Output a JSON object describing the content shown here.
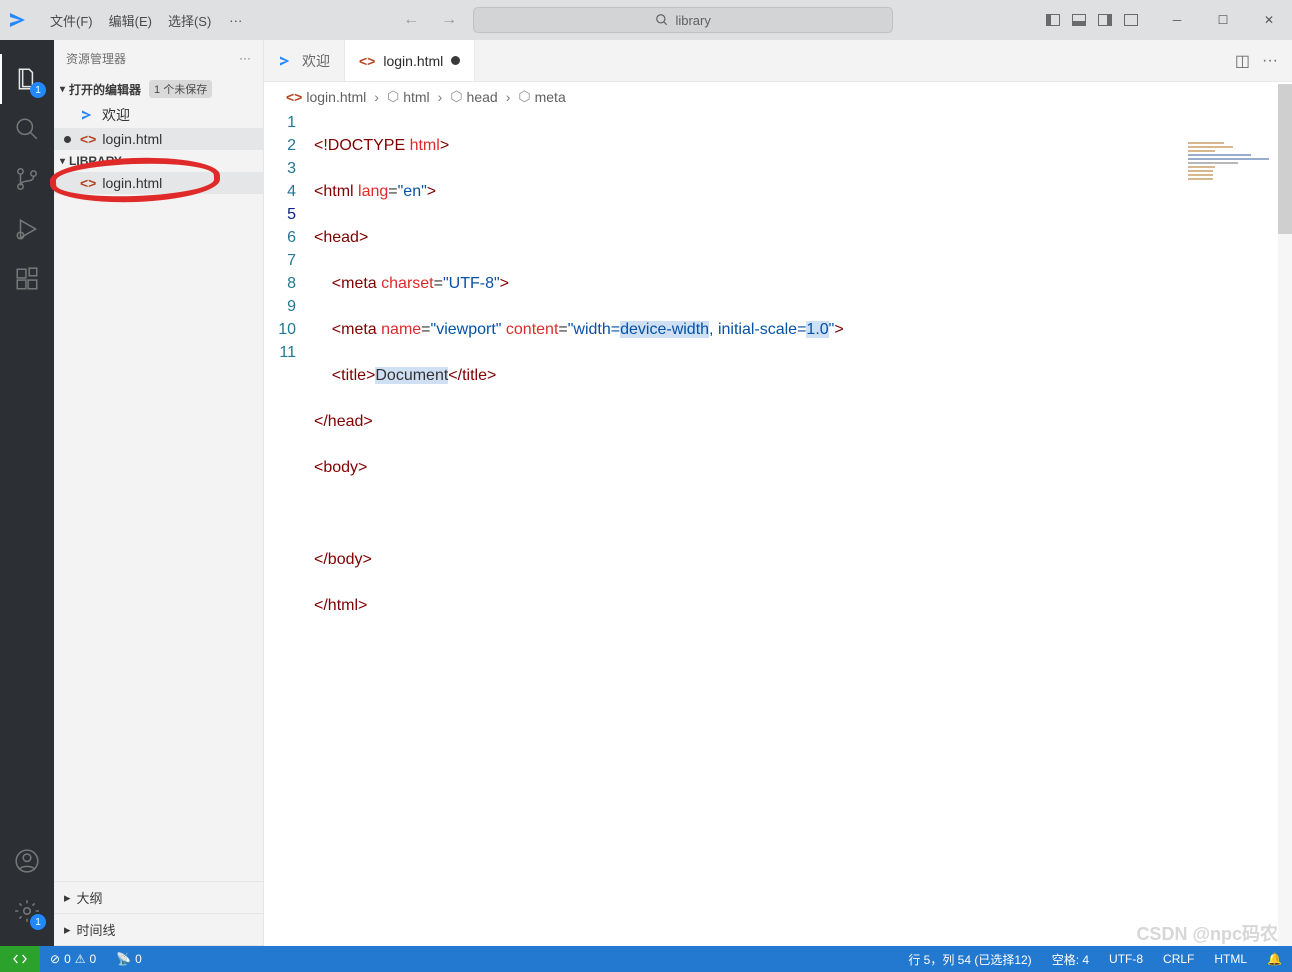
{
  "menu": {
    "file": "文件(F)",
    "edit": "编辑(E)",
    "select": "选择(S)"
  },
  "search": {
    "placeholder": "library"
  },
  "activity": {
    "explorer_badge": "1",
    "settings_badge": "1"
  },
  "sidebar": {
    "title": "资源管理器",
    "open_editors": "打开的编辑器",
    "unsaved": "1 个未保存",
    "welcome": "欢迎",
    "file1": "login.html",
    "folder": "LIBRARY",
    "folder_file": "login.html",
    "outline": "大纲",
    "timeline": "时间线"
  },
  "tabs": {
    "welcome": "欢迎",
    "login": "login.html"
  },
  "breadcrumb": {
    "file": "login.html",
    "html": "html",
    "head": "head",
    "meta": "meta"
  },
  "code": {
    "lines": [
      "1",
      "2",
      "3",
      "4",
      "5",
      "6",
      "7",
      "8",
      "9",
      "10",
      "11"
    ],
    "l1": {
      "a": "<!",
      "b": "DOCTYPE",
      "c": " html",
      "d": ">"
    },
    "l2": {
      "a": "<",
      "b": "html",
      "c": " lang",
      "d": "=",
      "e": "\"en\"",
      "f": ">"
    },
    "l3": {
      "a": "<",
      "b": "head",
      "c": ">"
    },
    "l4": {
      "indent": "    ",
      "a": "<",
      "b": "meta",
      "c": " charset",
      "d": "=",
      "e": "\"UTF-8\"",
      "f": ">"
    },
    "l5": {
      "indent": "    ",
      "a": "<",
      "b": "meta",
      "c": " name",
      "d": "=",
      "e": "\"viewport\"",
      "f": " content",
      "g": "=",
      "h": "\"width=",
      "i": "device-width",
      "j": ", initial-scale=",
      "k": "1.0",
      "l": "\"",
      "m": ">"
    },
    "l6": {
      "indent": "    ",
      "a": "<",
      "b": "title",
      "c": ">",
      "d": "Document",
      "e": "</",
      "f": "title",
      "g": ">"
    },
    "l7": {
      "a": "</",
      "b": "head",
      "c": ">"
    },
    "l8": {
      "a": "<",
      "b": "body",
      "c": ">"
    },
    "l9": {
      "indent": "    "
    },
    "l10": {
      "a": "</",
      "b": "body",
      "c": ">"
    },
    "l11": {
      "a": "</",
      "b": "html",
      "c": ">"
    }
  },
  "status": {
    "errors": "0",
    "warnings": "0",
    "ports": "0",
    "pos": "行 5，列 54 (已选择12)",
    "spaces": "空格: 4",
    "encoding": "UTF-8",
    "eol": "CRLF",
    "lang": "HTML"
  },
  "watermark": "CSDN @npc码农"
}
